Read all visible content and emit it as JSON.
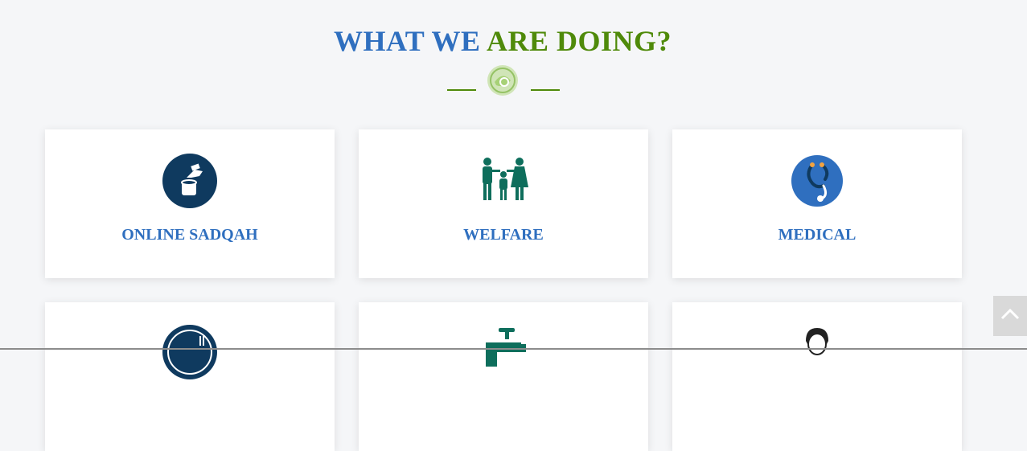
{
  "section": {
    "title_part1": "WHAT WE",
    "title_part2": "ARE DOING?"
  },
  "colors": {
    "title_blue": "#2f6fbf",
    "title_green": "#4f8a0a",
    "icon_navy": "#0f3a5f",
    "icon_teal": "#0e6e5c",
    "icon_blue": "#2f6fbf"
  },
  "services": [
    {
      "label": "ONLINE SADQAH",
      "icon": "donation-hand-icon"
    },
    {
      "label": "WELFARE",
      "icon": "family-icon"
    },
    {
      "label": "MEDICAL",
      "icon": "stethoscope-icon"
    },
    {
      "label": "",
      "icon": "food-plate-icon"
    },
    {
      "label": "",
      "icon": "water-tap-icon"
    },
    {
      "label": "",
      "icon": "person-icon"
    }
  ],
  "scroll_top": {
    "icon": "chevron-up-icon"
  }
}
